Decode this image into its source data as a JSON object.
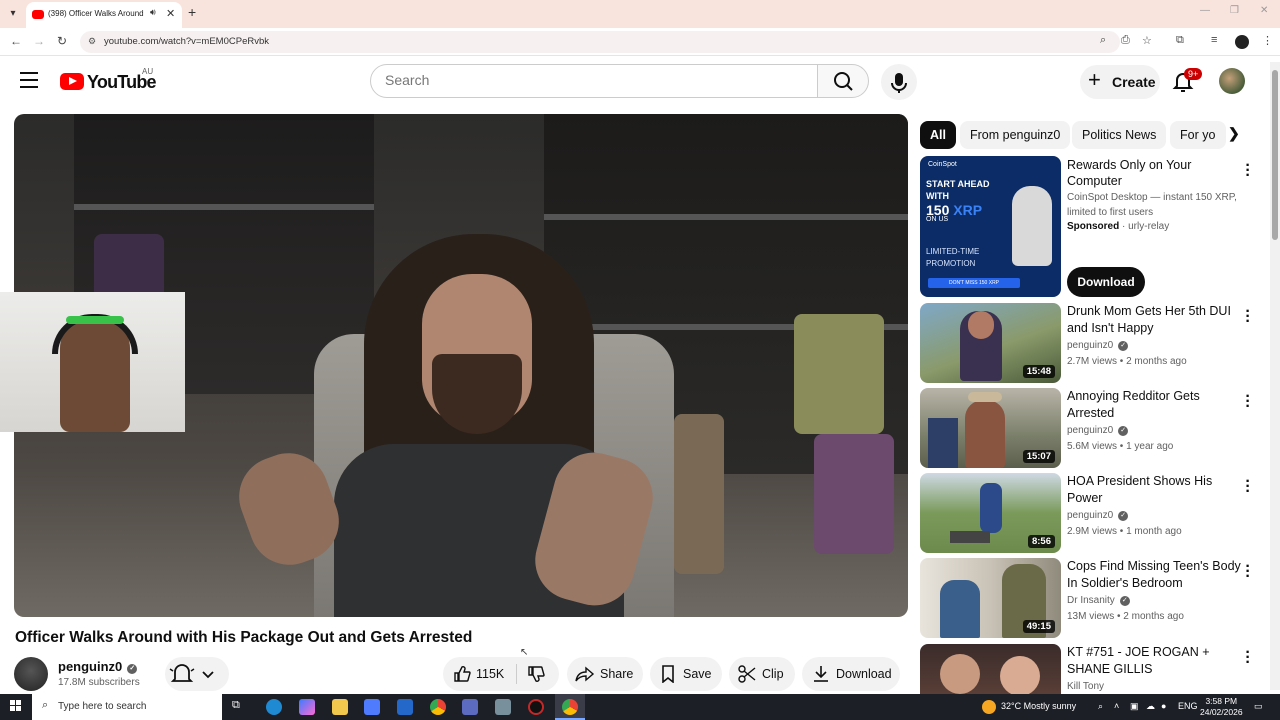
{
  "browser": {
    "tab_title": "(398) Officer Walks Around",
    "url": "youtube.com/watch?v=mEM0CPeRvbk"
  },
  "header": {
    "logo_text": "YouTube",
    "region": "AU",
    "search_placeholder": "Search",
    "create_label": "Create",
    "notification_count": "9+"
  },
  "video": {
    "title": "Officer Walks Around with His Package Out and Gets Arrested",
    "channel": "penguinz0",
    "subscribers": "17.8M subscribers",
    "likes": "115K",
    "share_label": "Share",
    "save_label": "Save",
    "clip_label": "Clip",
    "download_label": "Download"
  },
  "chips": [
    "All",
    "From penguinz0",
    "Politics News",
    "For yo"
  ],
  "ad": {
    "thumb_brand": "CoinSpot",
    "thumb_headline_1": "START AHEAD",
    "thumb_headline_2": "WITH",
    "thumb_amount": "150",
    "thumb_currency": "XRP",
    "thumb_onus": "ON US",
    "thumb_promo_1": "LIMITED-TIME",
    "thumb_promo_2": "PROMOTION",
    "thumb_cta": "DON'T MISS 150 XRP",
    "title": "Rewards Only on Your Computer",
    "description": "CoinSpot Desktop — instant 150 XRP, limited to first users",
    "sponsored": "Sponsored",
    "advertiser": "· urly-relay",
    "cta": "Download"
  },
  "recommendations": [
    {
      "title": "Drunk Mom Gets Her 5th DUI and Isn't Happy",
      "channel": "penguinz0",
      "meta": "2.7M views • 2 months ago",
      "duration": "15:48"
    },
    {
      "title": "Annoying Redditor Gets Arrested",
      "channel": "penguinz0",
      "meta": "5.6M views • 1 year ago",
      "duration": "15:07"
    },
    {
      "title": "HOA President Shows His Power",
      "channel": "penguinz0",
      "meta": "2.9M views • 1 month ago",
      "duration": "8:56"
    },
    {
      "title": "Cops Find Missing Teen's Body In Soldier's Bedroom",
      "channel": "Dr Insanity",
      "meta": "13M views • 2 months ago",
      "duration": "49:15"
    },
    {
      "title": "KT #751 - JOE ROGAN + SHANE GILLIS",
      "channel": "Kill Tony",
      "meta": "",
      "duration": ""
    }
  ],
  "taskbar": {
    "search_placeholder": "Type here to search",
    "weather": "32°C  Mostly sunny",
    "language": "ENG",
    "time": "3:58 PM",
    "date": "24/02/2026"
  },
  "colors": {
    "brand_red": "#ff0000",
    "chip_active": "#0f0f0f",
    "secondary_text": "#606060"
  }
}
